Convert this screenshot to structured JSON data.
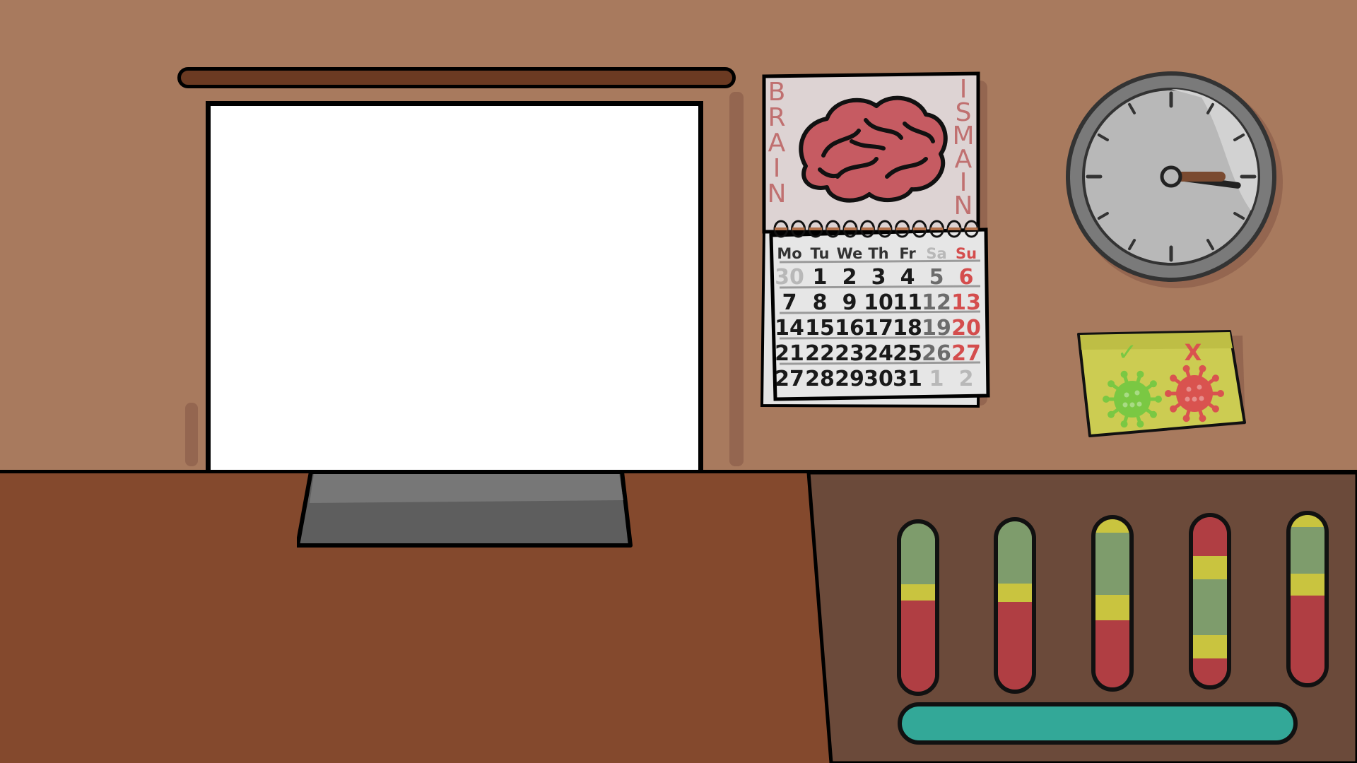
{
  "scene": {
    "colors": {
      "wall": "#a87a5e",
      "desk": "#84492d",
      "panel": "#6b4a3a",
      "screen": "#ffffff"
    },
    "screen_text": ""
  },
  "calendar": {
    "poster_left_letters": [
      "B",
      "R",
      "A",
      "I",
      "N"
    ],
    "poster_right_letters": [
      "I",
      "S",
      "M",
      "A",
      "I",
      "N"
    ],
    "weekdays": [
      "Mo",
      "Tu",
      "We",
      "Th",
      "Fr",
      "Sa",
      "Su"
    ],
    "weeks": [
      [
        "30",
        "1",
        "2",
        "3",
        "4",
        "5",
        "6"
      ],
      [
        "7",
        "8",
        "9",
        "10",
        "11",
        "12",
        "13"
      ],
      [
        "14",
        "15",
        "16",
        "17",
        "18",
        "19",
        "20"
      ],
      [
        "21",
        "22",
        "23",
        "24",
        "25",
        "26",
        "27"
      ],
      [
        "27",
        "28",
        "29",
        "30",
        "31",
        "1",
        "2"
      ]
    ]
  },
  "clock": {
    "hour": 3,
    "minute": 15
  },
  "sticky_note": {
    "check_symbol": "✓",
    "cross_symbol": "X",
    "good_color": "#7ac843",
    "bad_color": "#d9534f"
  },
  "tubes": [
    {
      "segments": [
        {
          "color": "#7e9c6c",
          "from": 0,
          "to": 0.36
        },
        {
          "color": "#c9c43f",
          "from": 0.36,
          "to": 0.46
        },
        {
          "color": "#b03e43",
          "from": 0.46,
          "to": 1
        }
      ]
    },
    {
      "segments": [
        {
          "color": "#7e9c6c",
          "from": 0,
          "to": 0.37
        },
        {
          "color": "#c9c43f",
          "from": 0.37,
          "to": 0.48
        },
        {
          "color": "#b03e43",
          "from": 0.48,
          "to": 1
        }
      ]
    },
    {
      "segments": [
        {
          "color": "#c9c43f",
          "from": 0,
          "to": 0.08
        },
        {
          "color": "#7e9c6c",
          "from": 0.08,
          "to": 0.45
        },
        {
          "color": "#c9c43f",
          "from": 0.45,
          "to": 0.6
        },
        {
          "color": "#b03e43",
          "from": 0.6,
          "to": 1
        }
      ]
    },
    {
      "segments": [
        {
          "color": "#b03e43",
          "from": 0,
          "to": 0.23
        },
        {
          "color": "#c9c43f",
          "from": 0.23,
          "to": 0.37
        },
        {
          "color": "#7e9c6c",
          "from": 0.37,
          "to": 0.7
        },
        {
          "color": "#c9c43f",
          "from": 0.7,
          "to": 0.84
        },
        {
          "color": "#b03e43",
          "from": 0.84,
          "to": 1
        }
      ]
    },
    {
      "segments": [
        {
          "color": "#c9c43f",
          "from": 0,
          "to": 0.07
        },
        {
          "color": "#7e9c6c",
          "from": 0.07,
          "to": 0.35
        },
        {
          "color": "#c9c43f",
          "from": 0.35,
          "to": 0.48
        },
        {
          "color": "#b03e43",
          "from": 0.48,
          "to": 1
        }
      ]
    }
  ],
  "progress": {
    "value": 1.0,
    "color": "#33a898"
  }
}
